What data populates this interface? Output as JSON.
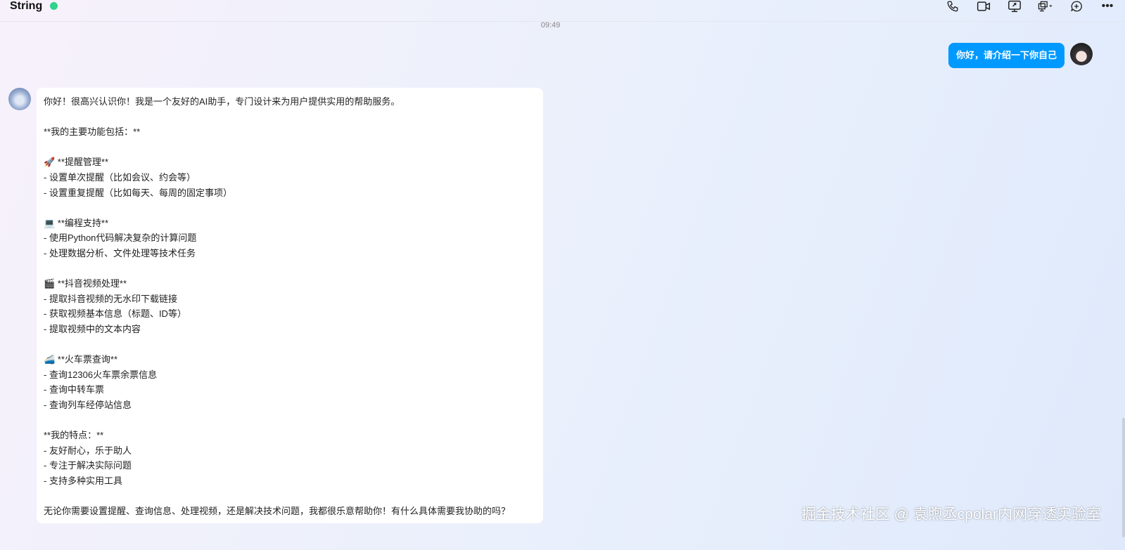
{
  "header": {
    "title": "String",
    "status_color": "#2fd38a",
    "icons": [
      "phone-icon",
      "video-call-icon",
      "screen-share-icon",
      "multi-screen-icon",
      "add-chat-icon",
      "more-icon"
    ]
  },
  "chat": {
    "timestamp": "09:49",
    "user_message": "你好，请介绍一下你自己",
    "bot_lines": [
      "你好！很高兴认识你！我是一个友好的AI助手，专门设计来为用户提供实用的帮助服务。",
      "",
      "**我的主要功能包括：**",
      "",
      "🚀 **提醒管理**",
      "- 设置单次提醒（比如会议、约会等）",
      "- 设置重复提醒（比如每天、每周的固定事项）",
      "",
      "💻 **编程支持**",
      "- 使用Python代码解决复杂的计算问题",
      "- 处理数据分析、文件处理等技术任务",
      "",
      "🎬 **抖音视频处理**",
      "- 提取抖音视频的无水印下载链接",
      "- 获取视频基本信息（标题、ID等）",
      "- 提取视频中的文本内容",
      "",
      "🚄 **火车票查询**",
      "- 查询12306火车票余票信息",
      "- 查询中转车票",
      "- 查询列车经停站信息",
      "",
      "**我的特点：**",
      "- 友好耐心，乐于助人",
      "- 专注于解决实际问题",
      "- 支持多种实用工具",
      "",
      "无论你需要设置提醒、查询信息、处理视频，还是解决技术问题，我都很乐意帮助你！有什么具体需要我协助的吗？"
    ]
  },
  "watermark": "掘金技术社区 @ 袁煦丞cpolar内网穿透实验室"
}
